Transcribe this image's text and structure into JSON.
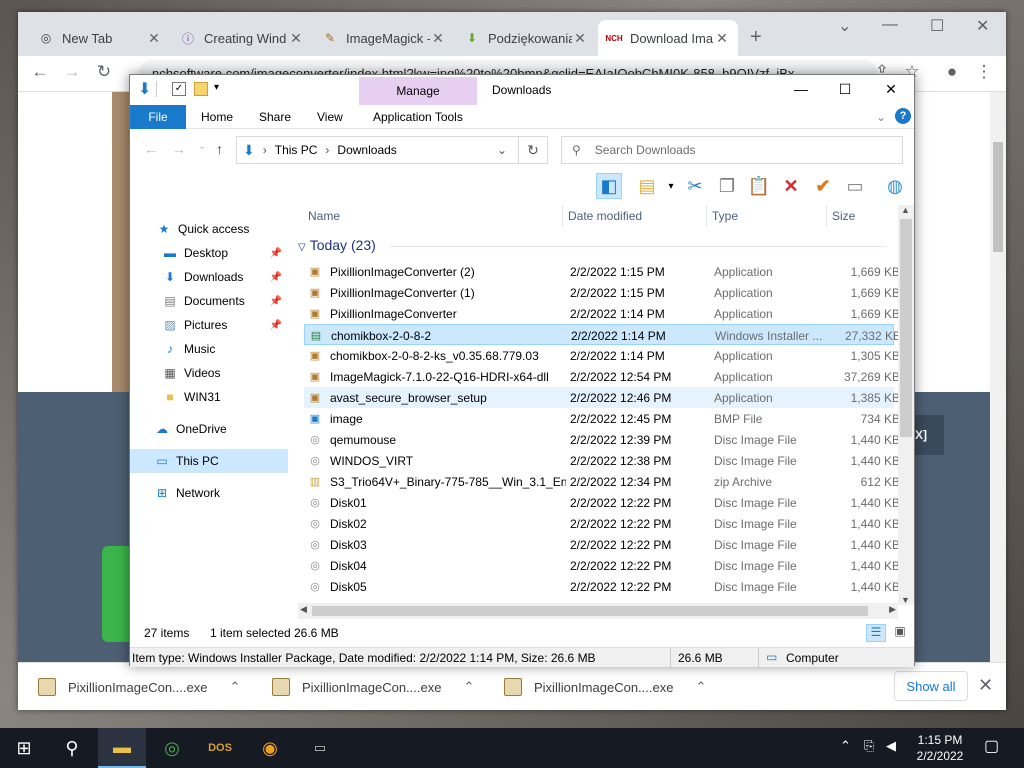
{
  "browser": {
    "tabs": [
      {
        "title": "New Tab",
        "icon": "chrome-icon"
      },
      {
        "title": "Creating Wind",
        "icon": "wiki-icon"
      },
      {
        "title": "ImageMagick -",
        "icon": "wand-icon"
      },
      {
        "title": "Podziękowania",
        "icon": "download-arrow-icon"
      },
      {
        "title": "Download Ima",
        "icon": "nch-icon",
        "active": true
      }
    ],
    "url": "nchsoftware.com/imageconverter/index.html?kw=jpg%20to%20bmp&gclid=EAIaIQobChMI0K-858_b9QIVzf_iBx",
    "webpage_button": "X]"
  },
  "explorer": {
    "title": "Downloads",
    "manage_tab": "Manage",
    "ribbon_tabs": [
      "File",
      "Home",
      "Share",
      "View",
      "Application Tools"
    ],
    "breadcrumb": [
      "This PC",
      "Downloads"
    ],
    "search_placeholder": "Search Downloads",
    "nav": [
      {
        "label": "Quick access",
        "icon": "star-icon",
        "indent": 0
      },
      {
        "label": "Desktop",
        "icon": "desktop-icon",
        "indent": 1,
        "pinned": true
      },
      {
        "label": "Downloads",
        "icon": "downloads-icon",
        "indent": 1,
        "pinned": true
      },
      {
        "label": "Documents",
        "icon": "documents-icon",
        "indent": 1,
        "pinned": true
      },
      {
        "label": "Pictures",
        "icon": "pictures-icon",
        "indent": 1,
        "pinned": true
      },
      {
        "label": "Music",
        "icon": "music-icon",
        "indent": 1
      },
      {
        "label": "Videos",
        "icon": "videos-icon",
        "indent": 1
      },
      {
        "label": "WIN31",
        "icon": "folder-icon",
        "indent": 1
      },
      {
        "label": "OneDrive",
        "icon": "cloud-icon",
        "indent": 0
      },
      {
        "label": "This PC",
        "icon": "computer-icon",
        "indent": 0,
        "selected": true
      },
      {
        "label": "Network",
        "icon": "network-icon",
        "indent": 0
      }
    ],
    "columns": [
      "Name",
      "Date modified",
      "Type",
      "Size"
    ],
    "group": "Today (23)",
    "files": [
      {
        "name": "PixillionImageConverter (2)",
        "date": "2/2/2022 1:15 PM",
        "type": "Application",
        "size": "1,669 KB"
      },
      {
        "name": "PixillionImageConverter (1)",
        "date": "2/2/2022 1:15 PM",
        "type": "Application",
        "size": "1,669 KB"
      },
      {
        "name": "PixillionImageConverter",
        "date": "2/2/2022 1:14 PM",
        "type": "Application",
        "size": "1,669 KB"
      },
      {
        "name": "chomikbox-2-0-8-2",
        "date": "2/2/2022 1:14 PM",
        "type": "Windows Installer ...",
        "size": "27,332 KB",
        "selected": true
      },
      {
        "name": "chomikbox-2-0-8-2-ks_v0.35.68.779.03",
        "date": "2/2/2022 1:14 PM",
        "type": "Application",
        "size": "1,305 KB"
      },
      {
        "name": "ImageMagick-7.1.0-22-Q16-HDRI-x64-dll",
        "date": "2/2/2022 12:54 PM",
        "type": "Application",
        "size": "37,269 KB"
      },
      {
        "name": "avast_secure_browser_setup",
        "date": "2/2/2022 12:46 PM",
        "type": "Application",
        "size": "1,385 KB",
        "hover": true
      },
      {
        "name": "image",
        "date": "2/2/2022 12:45 PM",
        "type": "BMP File",
        "size": "734 KB"
      },
      {
        "name": "qemumouse",
        "date": "2/2/2022 12:39 PM",
        "type": "Disc Image File",
        "size": "1,440 KB"
      },
      {
        "name": "WINDOS_VIRT",
        "date": "2/2/2022 12:38 PM",
        "type": "Disc Image File",
        "size": "1,440 KB"
      },
      {
        "name": "S3_Trio64V+_Binary-775-785__Win_3.1_En...",
        "date": "2/2/2022 12:34 PM",
        "type": "zip Archive",
        "size": "612 KB"
      },
      {
        "name": "Disk01",
        "date": "2/2/2022 12:22 PM",
        "type": "Disc Image File",
        "size": "1,440 KB"
      },
      {
        "name": "Disk02",
        "date": "2/2/2022 12:22 PM",
        "type": "Disc Image File",
        "size": "1,440 KB"
      },
      {
        "name": "Disk03",
        "date": "2/2/2022 12:22 PM",
        "type": "Disc Image File",
        "size": "1,440 KB"
      },
      {
        "name": "Disk04",
        "date": "2/2/2022 12:22 PM",
        "type": "Disc Image File",
        "size": "1,440 KB"
      },
      {
        "name": "Disk05",
        "date": "2/2/2022 12:22 PM",
        "type": "Disc Image File",
        "size": "1,440 KB"
      }
    ],
    "status": {
      "items": "27 items",
      "selected": "1 item selected",
      "selected_size": "26.6 MB"
    },
    "infobar": {
      "details": "Item type: Windows Installer Package, Date modified: 2/2/2022 1:14 PM, Size: 26.6 MB",
      "size": "26.6 MB",
      "location": "Computer"
    }
  },
  "shelf": {
    "downloads": [
      "PixillionImageCon....exe",
      "PixillionImageCon....exe",
      "PixillionImageCon....exe"
    ],
    "show_all": "Show all"
  },
  "taskbar": {
    "time": "1:15 PM",
    "date": "2/2/2022"
  }
}
